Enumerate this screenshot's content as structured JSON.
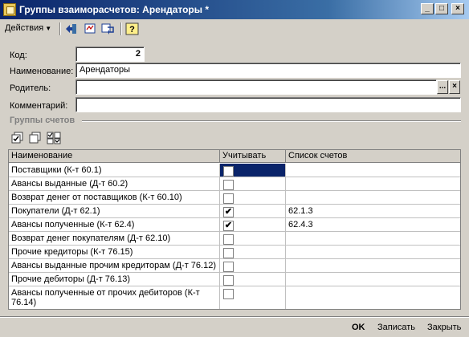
{
  "window": {
    "title": "Группы взаиморасчетов: Арендаторы *",
    "minimize": "_",
    "maximize": "□",
    "close": "×"
  },
  "toolbar": {
    "actions_label": "Действия",
    "help_label": "?"
  },
  "form": {
    "code_label": "Код:",
    "code_value": "2",
    "name_label": "Наименование:",
    "name_value": "Арендаторы",
    "parent_label": "Родитель:",
    "parent_value": "",
    "parent_select": "...",
    "parent_clear": "×",
    "comment_label": "Комментарий:",
    "comment_value": ""
  },
  "accounts_group": {
    "title": "Группы счетов"
  },
  "table": {
    "columns": [
      "Наименование",
      "Учитывать",
      "Список счетов"
    ],
    "rows": [
      {
        "name": "Поставщики (К-т 60.1)",
        "check": "",
        "accounts": ""
      },
      {
        "name": "Авансы выданные (Д-т 60.2)",
        "check": "",
        "accounts": ""
      },
      {
        "name": "Возврат денег от поставщиков (К-т 60.10)",
        "check": "",
        "accounts": ""
      },
      {
        "name": "Покупатели (Д-т 62.1)",
        "check": "✔",
        "accounts": "62.1.3"
      },
      {
        "name": "Авансы полученные (К-т 62.4)",
        "check": "✔",
        "accounts": "62.4.3"
      },
      {
        "name": "Возврат денег покупателям (Д-т 62.10)",
        "check": "",
        "accounts": ""
      },
      {
        "name": "Прочие кредиторы (К-т 76.15)",
        "check": "",
        "accounts": ""
      },
      {
        "name": "Авансы выданные прочим кредиторам (Д-т 76.12)",
        "check": "",
        "accounts": ""
      },
      {
        "name": "Прочие дебиторы (Д-т 76.13)",
        "check": "",
        "accounts": ""
      },
      {
        "name": "Авансы полученные от прочих дебиторов (К-т 76.14)",
        "check": "",
        "accounts": ""
      }
    ]
  },
  "footer": {
    "ok_label": "OK",
    "save_label": "Записать",
    "close_label": "Закрыть"
  }
}
